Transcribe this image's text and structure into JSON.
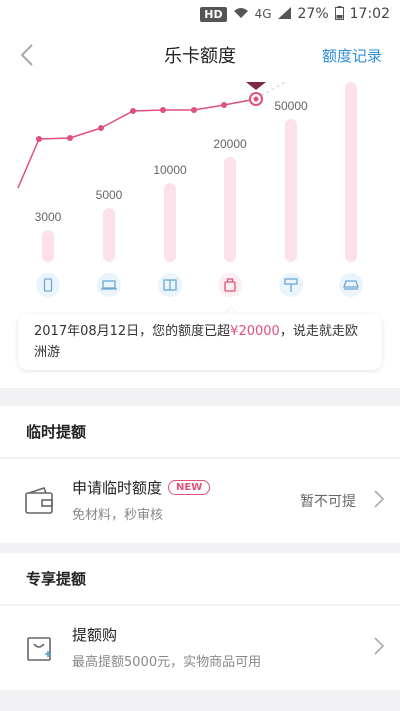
{
  "status_bar": {
    "hd": "HD",
    "network": "4G",
    "battery": "27%",
    "time": "17:02"
  },
  "nav": {
    "title": "乐卡额度",
    "back_icon": "chevron-left-icon",
    "records_label": "额度记录"
  },
  "chart": {
    "line_color": "#e0507b",
    "bar_color": "#fde1e8",
    "bar_labels": [
      "3000",
      "5000",
      "10000",
      "20000",
      "50000",
      ""
    ],
    "bar_icons": [
      "phone-icon",
      "laptop-icon",
      "book-icon",
      "bag-icon",
      "paint-roller-icon",
      "car-icon"
    ],
    "active_index": 3
  },
  "tooltip": {
    "prefix": "2017年08月12日，您的额度已超",
    "amount": "¥20000",
    "suffix": "，说走就走欧洲游"
  },
  "temp_section": {
    "title": "临时提额",
    "item": {
      "title": "申请临时额度",
      "badge": "NEW",
      "subtitle": "免材料，秒审核",
      "status": "暂不可提",
      "icon": "wallet-icon"
    }
  },
  "exclusive_section": {
    "title": "专享提额",
    "item": {
      "title": "提额购",
      "subtitle": "最高提额5000元，实物商品可用",
      "icon": "shopping-bag-icon"
    }
  }
}
